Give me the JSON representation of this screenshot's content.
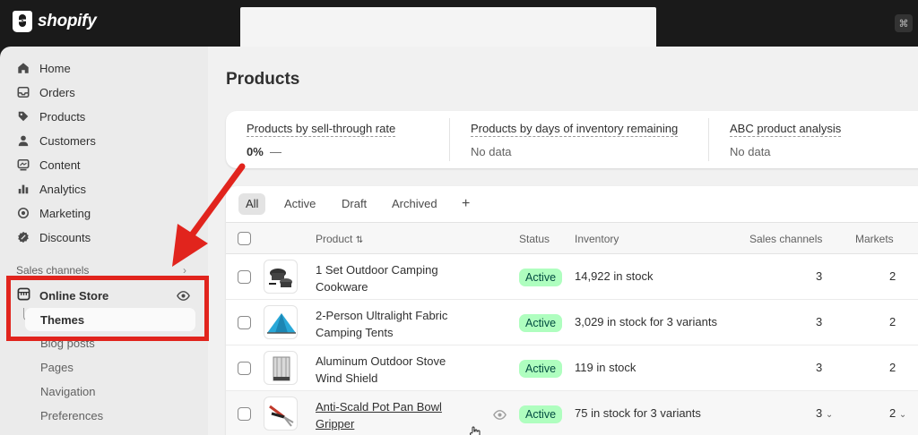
{
  "brand": {
    "name": "shopify"
  },
  "shortcut": {
    "label": "⌘"
  },
  "sidebar": {
    "items": [
      {
        "label": "Home",
        "icon": "home-icon"
      },
      {
        "label": "Orders",
        "icon": "inbox-icon"
      },
      {
        "label": "Products",
        "icon": "tag-icon"
      },
      {
        "label": "Customers",
        "icon": "person-icon"
      },
      {
        "label": "Content",
        "icon": "image-icon"
      },
      {
        "label": "Analytics",
        "icon": "bar-chart-icon"
      },
      {
        "label": "Marketing",
        "icon": "target-icon"
      },
      {
        "label": "Discounts",
        "icon": "discount-icon"
      }
    ],
    "section_label": "Sales channels",
    "online_store": "Online Store",
    "themes": "Themes",
    "sub_items": [
      "Blog posts",
      "Pages",
      "Navigation",
      "Preferences"
    ]
  },
  "main": {
    "title": "Products",
    "metrics": [
      {
        "title": "Products by sell-through rate",
        "value": "0%",
        "extra": "—"
      },
      {
        "title": "Products by days of inventory remaining",
        "value": "No data"
      },
      {
        "title": "ABC product analysis",
        "value": "No data"
      }
    ],
    "tabs": [
      "All",
      "Active",
      "Draft",
      "Archived",
      "+"
    ],
    "columns": {
      "product": "Product",
      "status": "Status",
      "inventory": "Inventory",
      "sales_channels": "Sales channels",
      "markets": "Markets"
    },
    "rows": [
      {
        "name": "1 Set Outdoor Camping Cookware",
        "status": "Active",
        "inventory": "14,922 in stock",
        "sales_channels": "3",
        "markets": "2"
      },
      {
        "name": "2-Person Ultralight Fabric Camping Tents",
        "status": "Active",
        "inventory": "3,029 in stock for 3 variants",
        "sales_channels": "3",
        "markets": "2"
      },
      {
        "name": "Aluminum Outdoor Stove Wind Shield",
        "status": "Active",
        "inventory": "119 in stock",
        "sales_channels": "3",
        "markets": "2"
      },
      {
        "name": "Anti-Scald Pot Pan Bowl Gripper",
        "status": "Active",
        "inventory": "75 in stock for 3 variants",
        "sales_channels": "3",
        "markets": "2"
      }
    ]
  },
  "colors": {
    "annotation": "#e1241d",
    "badge_bg": "#affebf",
    "badge_text": "#014b40"
  }
}
